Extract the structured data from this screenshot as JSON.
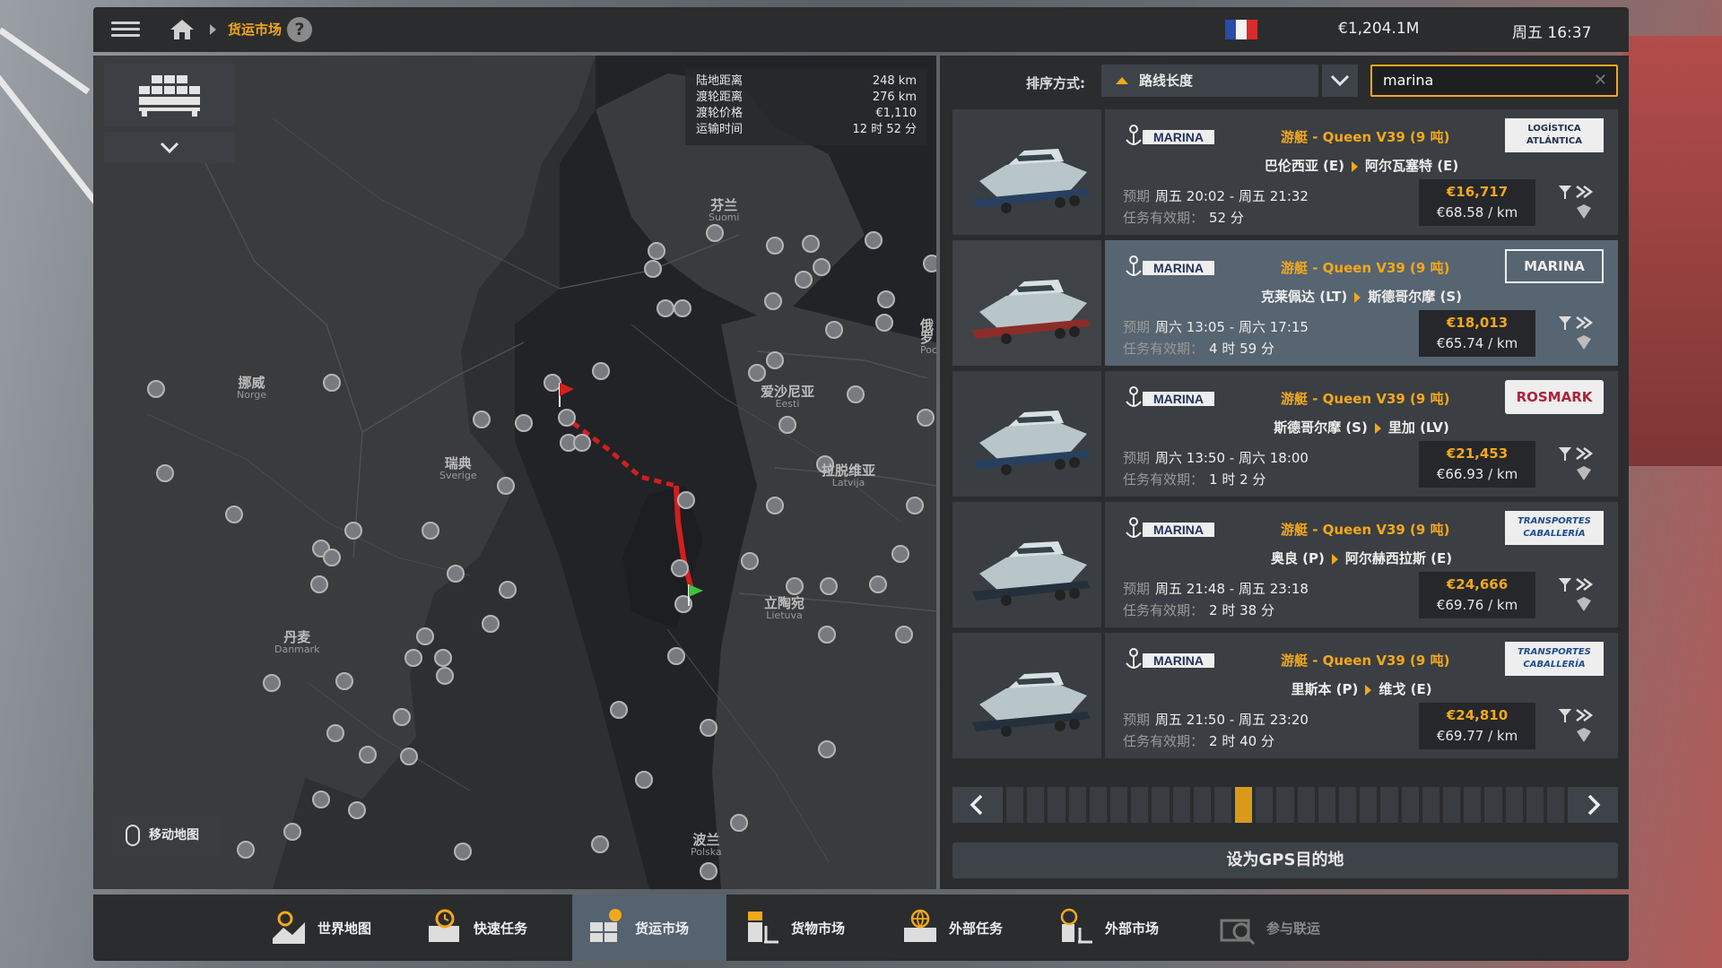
{
  "topbar": {
    "breadcrumb": "货运市场",
    "help": "?",
    "money": "€1,204.1M",
    "clock": "周五 16:37"
  },
  "map": {
    "info": [
      {
        "label": "陆地距离",
        "value": "248 km"
      },
      {
        "label": "渡轮距离",
        "value": "276 km"
      },
      {
        "label": "渡轮价格",
        "value": "€1,110"
      },
      {
        "label": "运输时间",
        "value": "12 时 52 分"
      }
    ],
    "countries": [
      {
        "name": "芬兰",
        "sub": "Suomi"
      },
      {
        "name": "挪威",
        "sub": "Norge"
      },
      {
        "name": "瑞典",
        "sub": "Sverige"
      },
      {
        "name": "爱沙尼亚",
        "sub": "Eesti"
      },
      {
        "name": "拉脱维亚",
        "sub": "Latvija"
      },
      {
        "name": "立陶宛",
        "sub": "Lietuva"
      },
      {
        "name": "丹麦",
        "sub": "Danmark"
      },
      {
        "name": "波兰",
        "sub": "Polska"
      },
      {
        "name": "俄罗",
        "sub": "Poc"
      }
    ],
    "move_label": "移动地图"
  },
  "sort": {
    "label": "排序方式:",
    "value": "路线长度"
  },
  "search": {
    "value": "marina",
    "clear": "✕"
  },
  "jobs": [
    {
      "brand": "MARINA",
      "cargo": "游艇 - Queen V39 (9 吨)",
      "from": "巴伦西亚 (E)",
      "to": "阿尔瓦塞特 (E)",
      "eta_label": "预期",
      "eta": "周五 20:02 - 周五 21:32",
      "valid_label": "任务有效期：",
      "valid": "52 分",
      "price": "€16,717",
      "rate": "€68.58 / km",
      "client": "LOGÍSTICA ATLÁNTICA"
    },
    {
      "brand": "MARINA",
      "cargo": "游艇 - Queen V39 (9 吨)",
      "from": "克莱佩达 (LT)",
      "to": "斯德哥尔摩 (S)",
      "eta_label": "预期",
      "eta": "周六 13:05 - 周六 17:15",
      "valid_label": "任务有效期：",
      "valid": "4 时 59 分",
      "price": "€18,013",
      "rate": "€65.74 / km",
      "client": "MARINA"
    },
    {
      "brand": "MARINA",
      "cargo": "游艇 - Queen V39 (9 吨)",
      "from": "斯德哥尔摩 (S)",
      "to": "里加 (LV)",
      "eta_label": "预期",
      "eta": "周六 13:50 - 周六 18:00",
      "valid_label": "任务有效期：",
      "valid": "1 时 2 分",
      "price": "€21,453",
      "rate": "€66.93 / km",
      "client": "ROSMARK"
    },
    {
      "brand": "MARINA",
      "cargo": "游艇 - Queen V39 (9 吨)",
      "from": "奥良 (P)",
      "to": "阿尔赫西拉斯 (E)",
      "eta_label": "预期",
      "eta": "周五 21:48 - 周五 23:18",
      "valid_label": "任务有效期：",
      "valid": "2 时 38 分",
      "price": "€24,666",
      "rate": "€69.76 / km",
      "client": "TRANSPORTES CABALLERÍA"
    },
    {
      "brand": "MARINA",
      "cargo": "游艇 - Queen V39 (9 吨)",
      "from": "里斯本 (P)",
      "to": "维戈 (E)",
      "eta_label": "预期",
      "eta": "周五 21:50 - 周五 23:20",
      "valid_label": "任务有效期：",
      "valid": "2 时 40 分",
      "price": "€24,810",
      "rate": "€69.77 / km",
      "client": "TRANSPORTES CABALLERÍA"
    }
  ],
  "pager": {
    "total": 27,
    "active": 11
  },
  "gps_button": "设为GPS目的地",
  "tabs": [
    {
      "label": "世界地图",
      "icon": "world-map-icon"
    },
    {
      "label": "快速任务",
      "icon": "quick-job-icon"
    },
    {
      "label": "货运市场",
      "icon": "freight-market-icon"
    },
    {
      "label": "货物市场",
      "icon": "cargo-market-icon"
    },
    {
      "label": "外部任务",
      "icon": "external-jobs-icon"
    },
    {
      "label": "外部市场",
      "icon": "external-market-icon"
    },
    {
      "label": "参与联运",
      "icon": "convoy-icon"
    }
  ],
  "colors": {
    "accent": "#f2a81b",
    "selected": "#576471",
    "route": "#d21f1f"
  }
}
